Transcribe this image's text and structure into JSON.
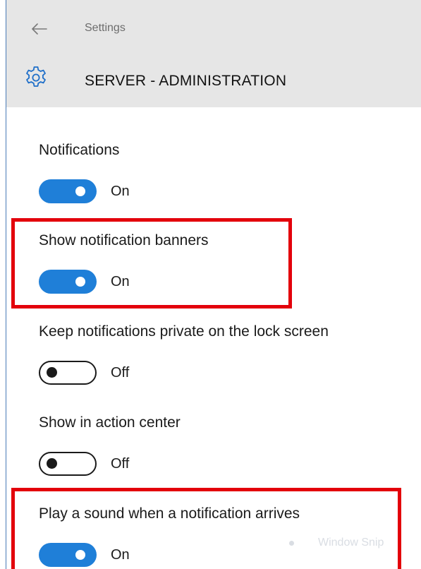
{
  "header": {
    "caption": "Settings",
    "title": "SERVER - ADMINISTRATION"
  },
  "settings": [
    {
      "label": "Notifications",
      "state": "On"
    },
    {
      "label": "Show notification banners",
      "state": "On"
    },
    {
      "label": "Keep notifications private on the lock screen",
      "state": "Off"
    },
    {
      "label": "Show in action center",
      "state": "Off"
    },
    {
      "label": "Play a sound when a notification arrives",
      "state": "On"
    }
  ],
  "background_hint": "Window Snip",
  "colors": {
    "accent": "#1f7fd8",
    "highlight": "#e3000b",
    "header_bg": "#e6e6e6"
  },
  "icons": {
    "back": "arrow-left-icon",
    "app": "gear-icon"
  }
}
